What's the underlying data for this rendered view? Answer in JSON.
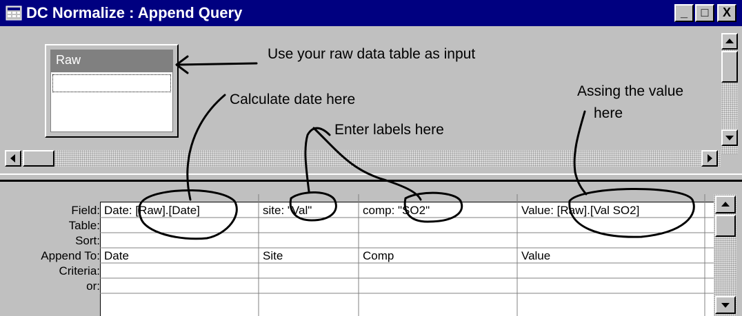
{
  "window": {
    "title": "DC Normalize : Append Query",
    "buttons": {
      "minimize": "_",
      "maximize": "□",
      "close": "X"
    }
  },
  "table": {
    "name": "Raw"
  },
  "annotations": {
    "input": "Use your raw data table as input",
    "date": "Calculate date here",
    "labels": "Enter labels here",
    "value_line1": "Assing the value",
    "value_line2": "here"
  },
  "grid": {
    "row_labels": [
      "Field:",
      "Table:",
      "Sort:",
      "Append To:",
      "Criteria:",
      "or:"
    ],
    "columns": [
      {
        "field": "Date: [Raw].[Date]",
        "append_to": "Date"
      },
      {
        "field": "site: \"Val\"",
        "append_to": "Site"
      },
      {
        "field": "comp: \"SO2\"",
        "append_to": "Comp"
      },
      {
        "field": "Value: [Raw].[Val SO2]",
        "append_to": "Value"
      }
    ]
  }
}
